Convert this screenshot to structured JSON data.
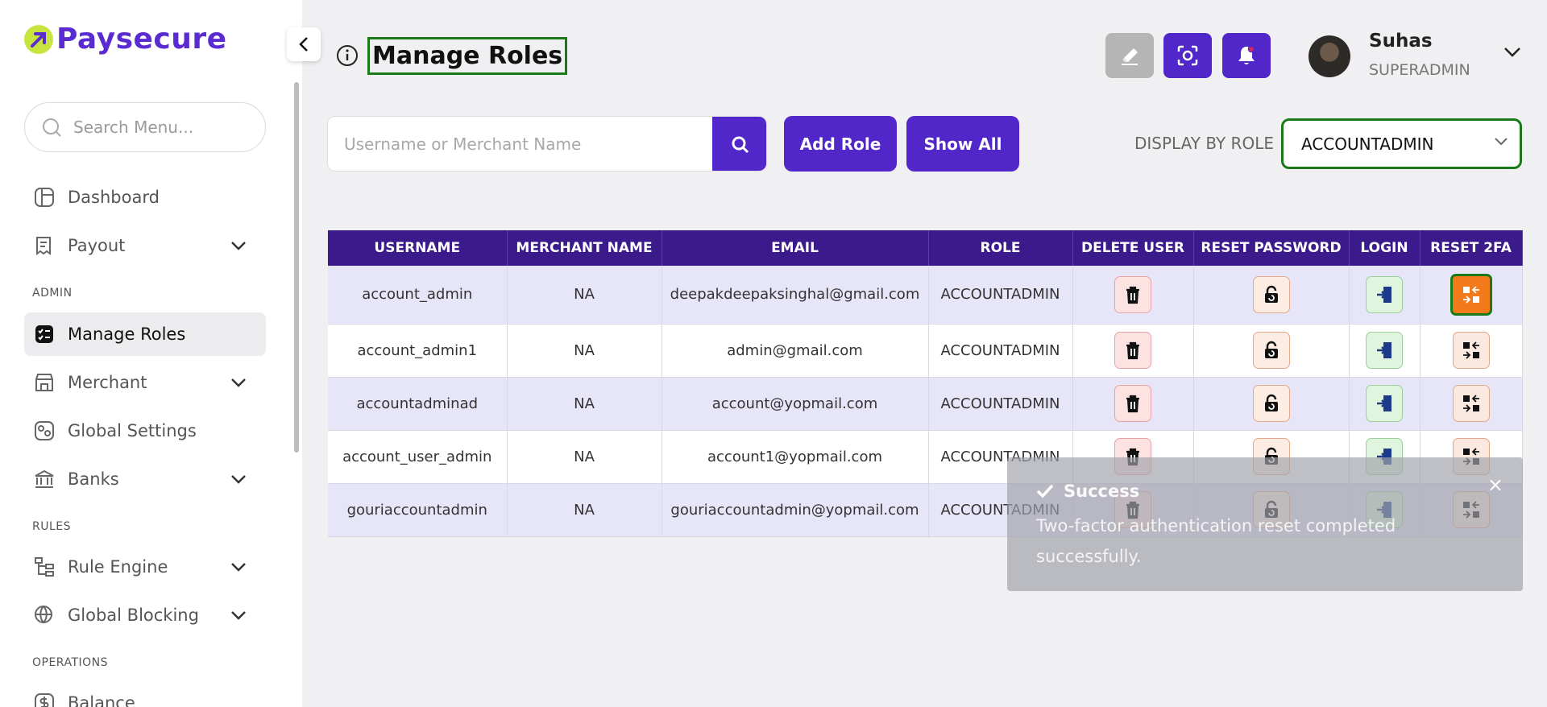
{
  "brand": {
    "name": "Paysecure"
  },
  "sidebar": {
    "search_placeholder": "Search Menu...",
    "items": [
      {
        "label": "Dashboard"
      },
      {
        "label": "Payout"
      },
      {
        "label": "Manage Roles"
      },
      {
        "label": "Merchant"
      },
      {
        "label": "Global Settings"
      },
      {
        "label": "Banks"
      },
      {
        "label": "Rule Engine"
      },
      {
        "label": "Global Blocking"
      },
      {
        "label": "Balance"
      }
    ],
    "sections": {
      "admin": "ADMIN",
      "rules": "RULES",
      "operations": "OPERATIONS"
    }
  },
  "header": {
    "title": "Manage Roles",
    "user": {
      "name": "Suhas",
      "role": "SUPERADMIN"
    }
  },
  "toolbar": {
    "search_placeholder": "Username or Merchant Name",
    "add_role_label": "Add Role",
    "show_all_label": "Show All",
    "display_by_role_label": "DISPLAY BY ROLE",
    "selected_role": "ACCOUNTADMIN"
  },
  "table": {
    "columns": [
      "USERNAME",
      "MERCHANT NAME",
      "EMAIL",
      "ROLE",
      "DELETE USER",
      "RESET PASSWORD",
      "LOGIN",
      "RESET 2FA"
    ],
    "rows": [
      {
        "username": "account_admin",
        "merchant": "NA",
        "email": "deepakdeepaksinghal@gmail.com",
        "role": "ACCOUNTADMIN"
      },
      {
        "username": "account_admin1",
        "merchant": "NA",
        "email": "admin@gmail.com",
        "role": "ACCOUNTADMIN"
      },
      {
        "username": "accountadminad",
        "merchant": "NA",
        "email": "account@yopmail.com",
        "role": "ACCOUNTADMIN"
      },
      {
        "username": "account_user_admin",
        "merchant": "NA",
        "email": "account1@yopmail.com",
        "role": "ACCOUNTADMIN"
      },
      {
        "username": "gouriaccountadmin",
        "merchant": "NA",
        "email": "gouriaccountadmin@yopmail.com",
        "role": "ACCOUNTADMIN"
      }
    ]
  },
  "toast": {
    "title": "Success",
    "message": "Two-factor authentication reset completed successfully.",
    "close": "×"
  },
  "colors": {
    "brand": "#5a2bd0",
    "header_bg": "#3b1a8c",
    "accent": "#5227c9",
    "highlight": "#1a7a1a"
  },
  "icons": {
    "header": [
      "eraser-icon",
      "scan-icon",
      "bell-icon"
    ],
    "row_actions": [
      "trash-icon",
      "unlock-icon",
      "login-icon",
      "reset-2fa-icon"
    ]
  }
}
